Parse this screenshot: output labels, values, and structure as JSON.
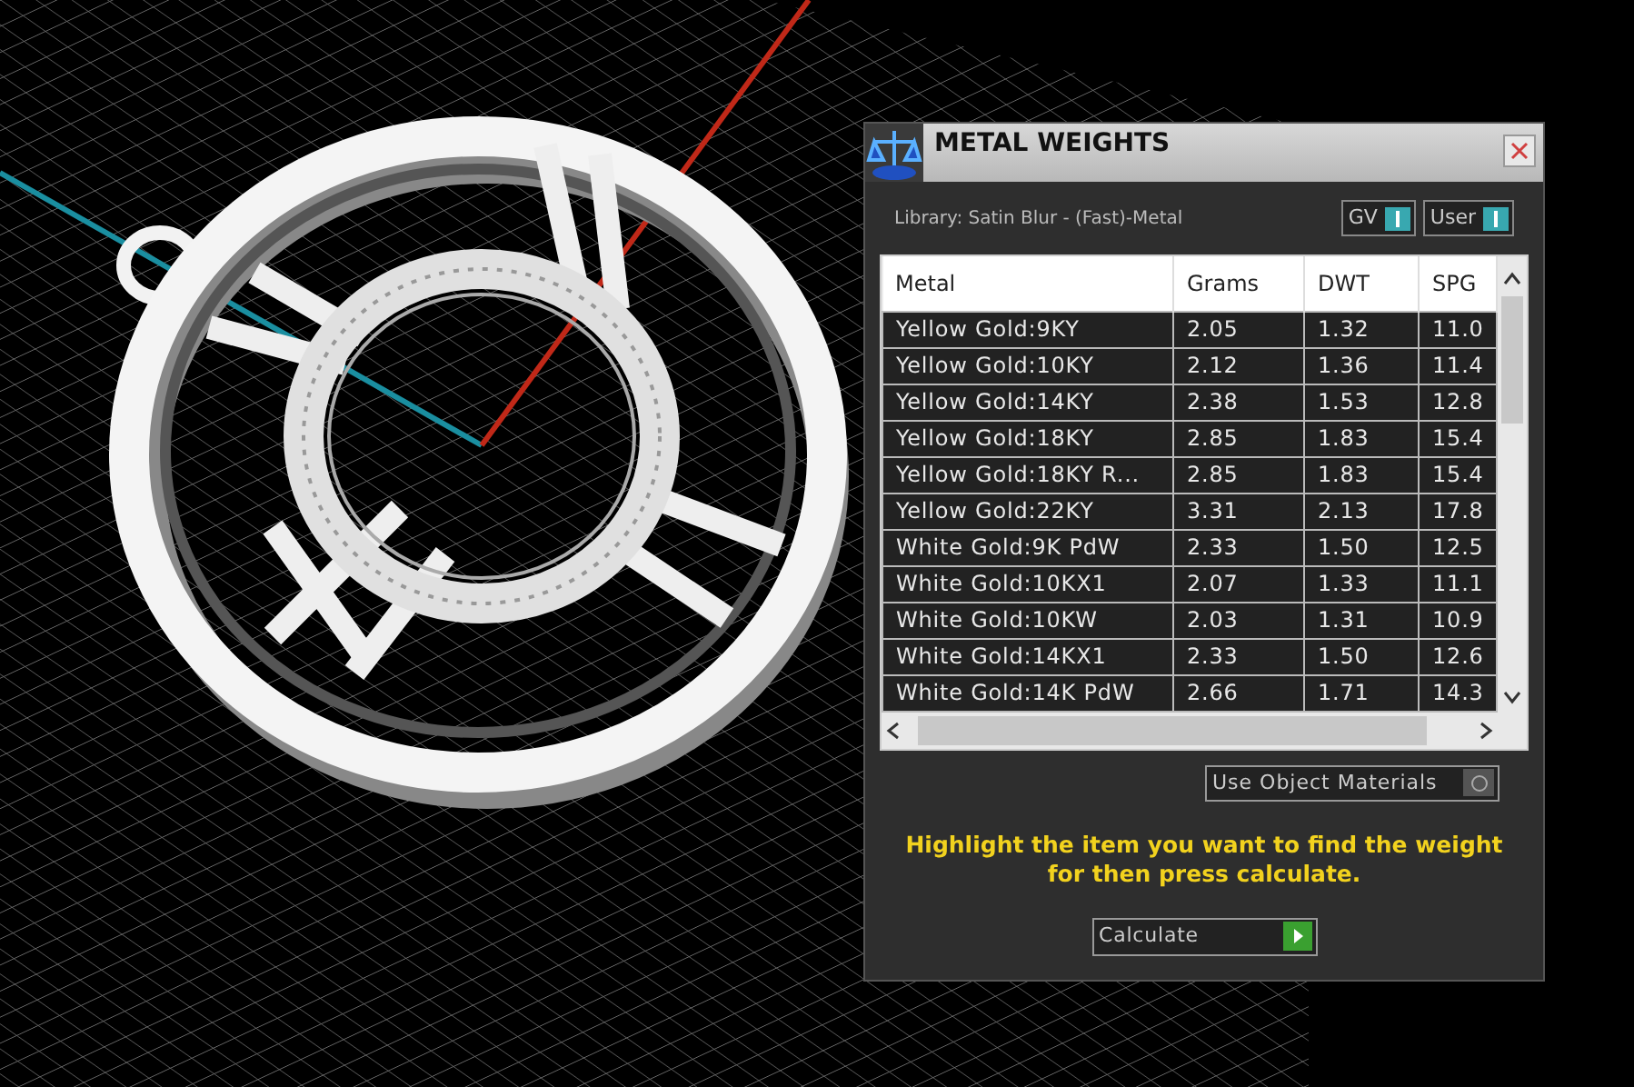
{
  "window": {
    "title": "METAL WEIGHTS"
  },
  "library": "Library: Satin Blur - (Fast)-Metal",
  "toggles": [
    {
      "label": "GV",
      "on": true
    },
    {
      "label": "User",
      "on": true
    }
  ],
  "table": {
    "columns": [
      "Metal",
      "Grams",
      "DWT",
      "SPG"
    ],
    "rows": [
      {
        "cells": [
          "Yellow Gold:9KY",
          "2.05",
          "1.32",
          "11.0"
        ],
        "selected": false
      },
      {
        "cells": [
          "Yellow Gold:10KY",
          "2.12",
          "1.36",
          "11.4"
        ],
        "selected": false
      },
      {
        "cells": [
          "Yellow Gold:14KY",
          "2.38",
          "1.53",
          "12.8"
        ],
        "selected": false
      },
      {
        "cells": [
          "Yellow Gold:18KY",
          "2.85",
          "1.83",
          "15.4"
        ],
        "selected": false
      },
      {
        "cells": [
          "Yellow Gold:18KY R...",
          "2.85",
          "1.83",
          "15.4"
        ],
        "selected": false
      },
      {
        "cells": [
          "Yellow Gold:22KY",
          "3.31",
          "2.13",
          "17.8"
        ],
        "selected": false
      },
      {
        "cells": [
          "White Gold:9K PdW",
          "2.33",
          "1.50",
          "12.5"
        ],
        "selected": false
      },
      {
        "cells": [
          "White Gold:10KX1",
          "2.07",
          "1.33",
          "11.1"
        ],
        "selected": false
      },
      {
        "cells": [
          "White Gold:10KW",
          "2.03",
          "1.31",
          "10.9"
        ],
        "selected": false
      },
      {
        "cells": [
          "White Gold:14KX1",
          "2.33",
          "1.50",
          "12.6"
        ],
        "selected": false
      },
      {
        "cells": [
          "White Gold:14K PdW",
          "2.66",
          "1.71",
          "14.3"
        ],
        "selected": false
      }
    ]
  },
  "use_object_materials": {
    "label": "Use Object Materials",
    "checked": false
  },
  "hint": "Highlight the item you want to find the weight for then press calculate.",
  "calculate": "Calculate"
}
